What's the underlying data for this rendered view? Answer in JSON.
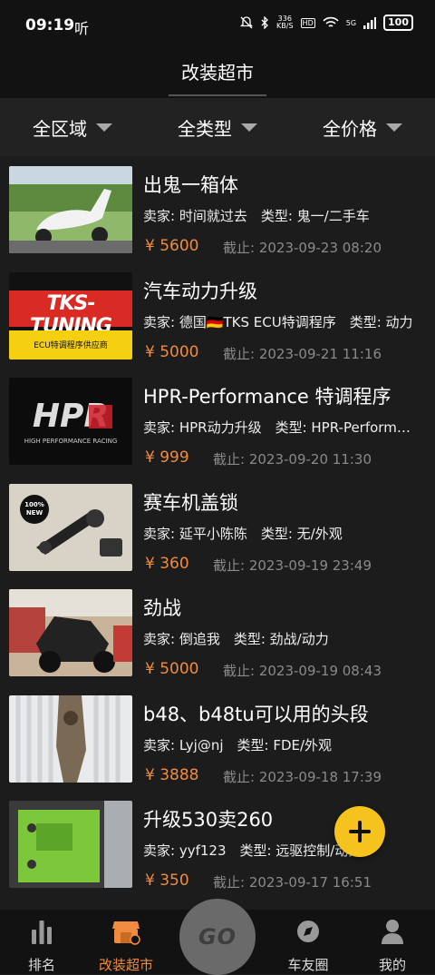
{
  "status_bar": {
    "time": "09:19",
    "extra": "听",
    "net_speed_value": "336",
    "net_speed_unit": "KB/S",
    "hd": "HD",
    "signal": "5G",
    "battery": "100"
  },
  "header": {
    "title": "改装超市"
  },
  "filters": [
    {
      "label": "全区域"
    },
    {
      "label": "全类型"
    },
    {
      "label": "全价格"
    }
  ],
  "items": [
    {
      "title": "出鬼一箱体",
      "meta": "卖家: 时间就过去　类型: 鬼一/二手车",
      "price": "¥ 5600",
      "deadline": "截止: 2023-09-23 08:20",
      "thumb": "scooter-photo"
    },
    {
      "title": "汽车动力升级",
      "meta": "卖家: 德国🇩🇪TKS ECU特调程序　类型: 动力",
      "price": "¥ 5000",
      "deadline": "截止: 2023-09-21 11:16",
      "thumb": "tks-tuning-logo",
      "thumb_text": "TKS-TUNING",
      "thumb_sub": "ECU特调程序供应商"
    },
    {
      "title": "HPR-Performance 特调程序",
      "meta": "卖家: HPR动力升级　类型: HPR-Performance",
      "price": "¥ 999",
      "deadline": "截止: 2023-09-20 11:30",
      "thumb": "hpr-logo",
      "thumb_text": "HPR",
      "thumb_sub": "HIGH PERFORMANCE RACING"
    },
    {
      "title": "赛车机盖锁",
      "meta": "卖家: 延平小陈陈　类型: 无/外观",
      "price": "¥ 360",
      "deadline": "截止: 2023-09-19 23:49",
      "thumb": "hood-lock-photo",
      "thumb_text": "100% NEW"
    },
    {
      "title": "劲战",
      "meta": "卖家: 倒追我　类型: 劲战/动力",
      "price": "¥ 5000",
      "deadline": "截止: 2023-09-19 08:43",
      "thumb": "motorcycle-photo"
    },
    {
      "title": "b48、b48tu可以用的头段",
      "meta": "卖家: Lyj@nj　类型: FDE/外观",
      "price": "¥ 3888",
      "deadline": "截止: 2023-09-18 17:39",
      "thumb": "exhaust-pipe-photo"
    },
    {
      "title": "升级530卖260",
      "meta": "卖家: yyf123　类型: 远驱控制/动力",
      "price": "¥ 350",
      "deadline": "截止: 2023-09-17 16:51",
      "thumb": "green-parts-photo"
    }
  ],
  "fab": {
    "icon": "plus-icon",
    "color": "#f6c21d"
  },
  "nav": {
    "items": [
      {
        "label": "排名",
        "icon": "bar-chart-icon"
      },
      {
        "label": "改装超市",
        "icon": "shop-icon",
        "active": true
      },
      {
        "label": "车友圈",
        "icon": "compass-icon"
      },
      {
        "label": "我的",
        "icon": "user-icon"
      }
    ],
    "center": "GO"
  },
  "colors": {
    "accent": "#f08b3f",
    "background": "#1c1c1c",
    "fab": "#f6c21d"
  }
}
